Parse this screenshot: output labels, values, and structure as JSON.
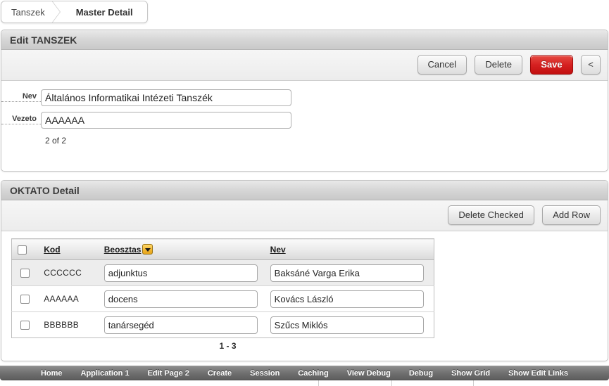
{
  "breadcrumb": {
    "items": [
      {
        "label": "Tanszek",
        "current": false
      },
      {
        "label": "Master Detail",
        "current": true
      }
    ]
  },
  "master_region": {
    "title": "Edit TANSZEK",
    "buttons": [
      {
        "name": "cancel",
        "label": "Cancel",
        "style": "normal"
      },
      {
        "name": "delete",
        "label": "Delete",
        "style": "normal"
      },
      {
        "name": "save",
        "label": "Save",
        "style": "hot",
        "color": "#d62121"
      },
      {
        "name": "back",
        "label": "<",
        "style": "small"
      }
    ],
    "fields": [
      {
        "name": "nev",
        "label": "Nev",
        "value": "Általános Informatikai Intézeti Tanszék",
        "placeholder": ""
      },
      {
        "name": "vezeto",
        "label": "Vezeto",
        "value": "AAAAAA",
        "placeholder": ""
      }
    ],
    "row_count": "2 of 2"
  },
  "detail_region": {
    "title": "OKTATO Detail",
    "buttons": [
      {
        "name": "delete-checked",
        "label": "Delete Checked"
      },
      {
        "name": "add-row",
        "label": "Add Row"
      }
    ],
    "columns": [
      {
        "name": "select",
        "label": "",
        "sortable": false
      },
      {
        "name": "kod",
        "label": "Kod",
        "sortable": true
      },
      {
        "name": "beosztas",
        "label": "Beosztas",
        "sortable": true,
        "sort_icon": "chevron-down-icon"
      },
      {
        "name": "nev",
        "label": "Nev",
        "sortable": true
      }
    ],
    "rows": [
      {
        "checked": false,
        "kod": "CCCCCC",
        "beosztas": "adjunktus",
        "nev": "Baksáné Varga Erika"
      },
      {
        "checked": false,
        "kod": "AAAAAA",
        "beosztas": "docens",
        "nev": "Kovács László"
      },
      {
        "checked": false,
        "kod": "BBBBBB",
        "beosztas": "tanársegéd",
        "nev": "Szűcs Miklós"
      }
    ],
    "pagination": "1 - 3"
  },
  "dev_toolbar": {
    "items": [
      {
        "name": "home",
        "label": "Home"
      },
      {
        "name": "application-1",
        "label": "Application 1"
      },
      {
        "name": "edit-page-2",
        "label": "Edit Page 2"
      },
      {
        "name": "create",
        "label": "Create"
      },
      {
        "name": "session",
        "label": "Session"
      },
      {
        "name": "caching",
        "label": "Caching"
      },
      {
        "name": "view-debug",
        "label": "View Debug"
      },
      {
        "name": "debug",
        "label": "Debug"
      },
      {
        "name": "show-grid",
        "label": "Show Grid"
      },
      {
        "name": "show-edit-links",
        "label": "Show Edit Links"
      }
    ]
  }
}
